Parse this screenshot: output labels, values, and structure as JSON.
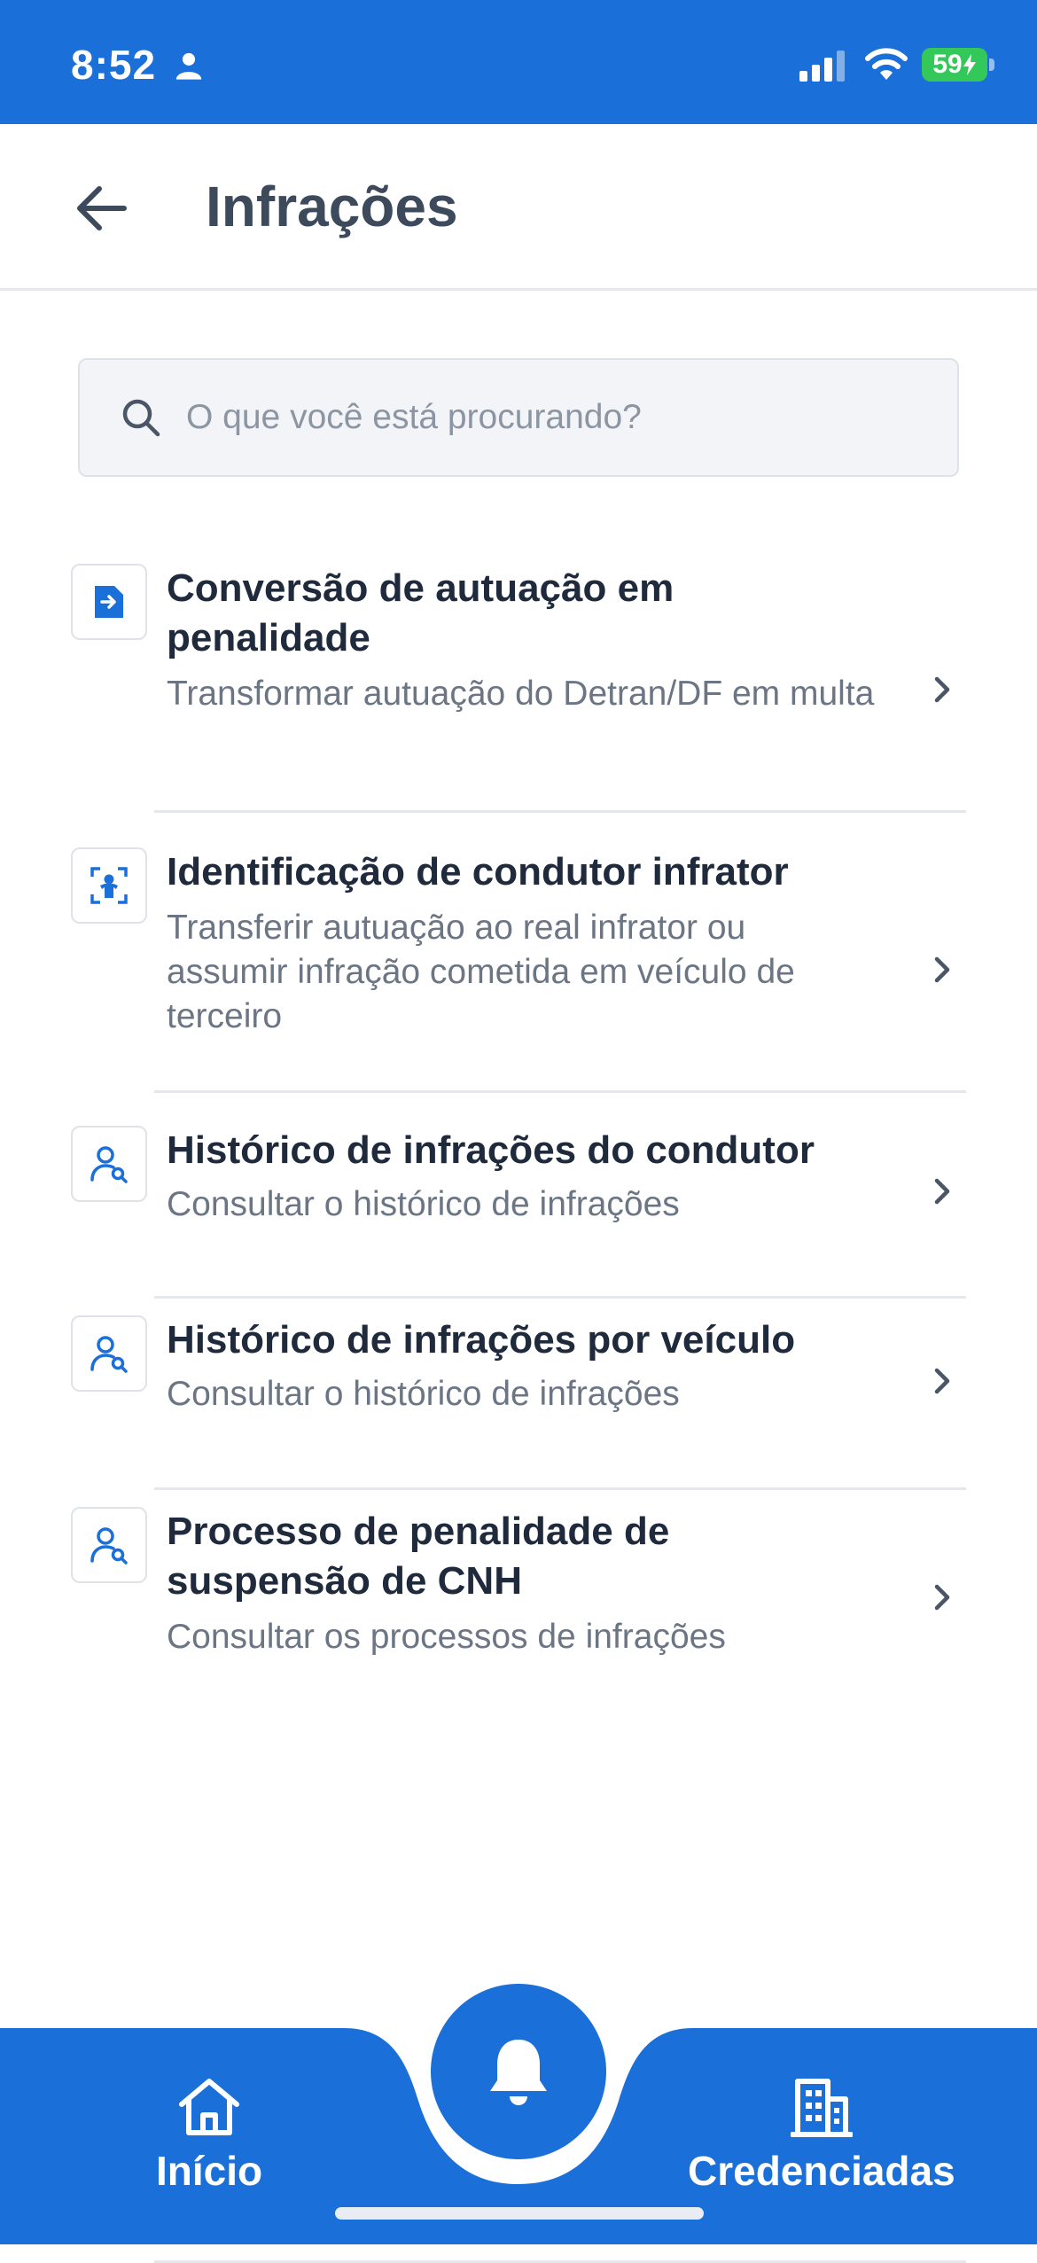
{
  "status_bar": {
    "time": "8:52",
    "battery": "59"
  },
  "header": {
    "title": "Infrações"
  },
  "search": {
    "placeholder": "O que você está procurando?"
  },
  "items": [
    {
      "title": "Conversão de autuação em penalidade",
      "description": "Transformar autuação do Detran/DF em multa",
      "icon": "file-arrow-icon"
    },
    {
      "title": "Identificação de condutor infrator",
      "description": "Transferir autuação ao real infrator ou assumir infração cometida em veículo de terceiro",
      "icon": "person-scan-icon"
    },
    {
      "title": "Histórico de infrações do condutor",
      "description": "Consultar o histórico de infrações",
      "icon": "person-search-icon"
    },
    {
      "title": "Histórico de infrações por veículo",
      "description": "Consultar o histórico de infrações",
      "icon": "person-search-icon"
    },
    {
      "title": "Processo de penalidade de suspensão de CNH",
      "description": "Consultar os processos de infrações",
      "icon": "person-search-icon"
    }
  ],
  "bottom_nav": {
    "home_label": "Início",
    "credentials_label": "Credenciadas"
  },
  "colors": {
    "brand": "#1a6fd8",
    "battery": "#34c759"
  }
}
